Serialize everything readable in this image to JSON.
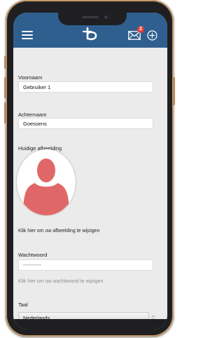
{
  "app": {
    "header_color": "#2f5f8f",
    "notification_count": "2",
    "icons": {
      "menu": "hamburger-menu-icon",
      "logo": "b-logo-icon",
      "mail": "envelope-icon",
      "add": "plus-circle-icon",
      "avatar": "person-silhouette-icon",
      "dropdown": "chevron-icon"
    }
  },
  "profile": {
    "first_name_label": "Voornaam",
    "first_name_value": "Gebruiker 1",
    "last_name_label": "Achternaam",
    "last_name_value": "Goessens",
    "picture_label": "Huidige afbeelding",
    "picture_change_link": "Klik hier om uw afbeelding te wijzigen",
    "password_label": "Wachtwoord",
    "password_value": "••••••••••",
    "password_change_link": "Klik hier om uw wachtwoord te wijzigen",
    "language_label": "Taal",
    "language_value": "Nederlands"
  }
}
